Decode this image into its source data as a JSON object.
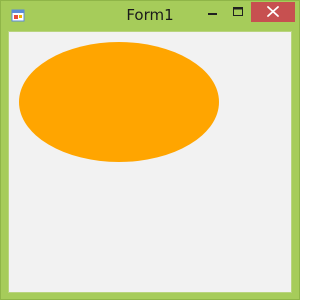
{
  "window": {
    "title": "Form1"
  },
  "icons": {
    "app": "windows-forms-app-icon",
    "minimize": "minimize-icon",
    "maximize": "maximize-icon",
    "close": "close-icon"
  },
  "canvas": {
    "shape": "ellipse",
    "fill_color": "#ffa500"
  },
  "colors": {
    "frame": "#a6cc5a",
    "client_background": "#f2f2f2",
    "close_button": "#c75050"
  }
}
